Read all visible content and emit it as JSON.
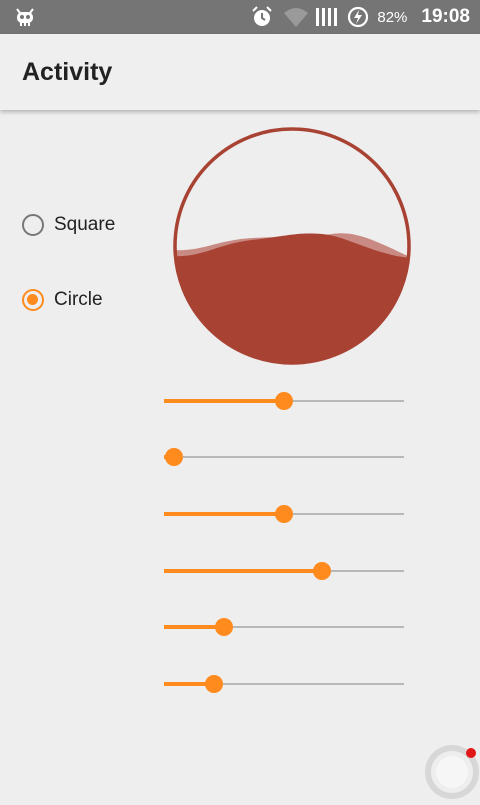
{
  "statusbar": {
    "battery_percent": "82%",
    "time": "19:08",
    "icons": [
      "android-debug-icon",
      "alarm-icon",
      "wifi-icon",
      "signal-icon",
      "battery-charging-icon"
    ]
  },
  "appbar": {
    "title": "Activity"
  },
  "shape_options": [
    {
      "label": "Square",
      "checked": false
    },
    {
      "label": "Circle",
      "checked": true
    }
  ],
  "wave_view": {
    "shape": "circle",
    "border_color": "#a84233",
    "front_wave_color": "#a84233",
    "behind_wave_color": "#c88a82",
    "water_level": 0.5
  },
  "sliders": [
    {
      "name": "slider-1",
      "value": 0.5
    },
    {
      "name": "slider-2",
      "value": 0.04
    },
    {
      "name": "slider-3",
      "value": 0.5
    },
    {
      "name": "slider-4",
      "value": 0.66
    },
    {
      "name": "slider-5",
      "value": 0.25
    },
    {
      "name": "slider-6",
      "value": 0.21
    }
  ],
  "colors": {
    "accent": "#ff8a1e",
    "statusbar": "#757575",
    "background": "#eeeeee"
  }
}
